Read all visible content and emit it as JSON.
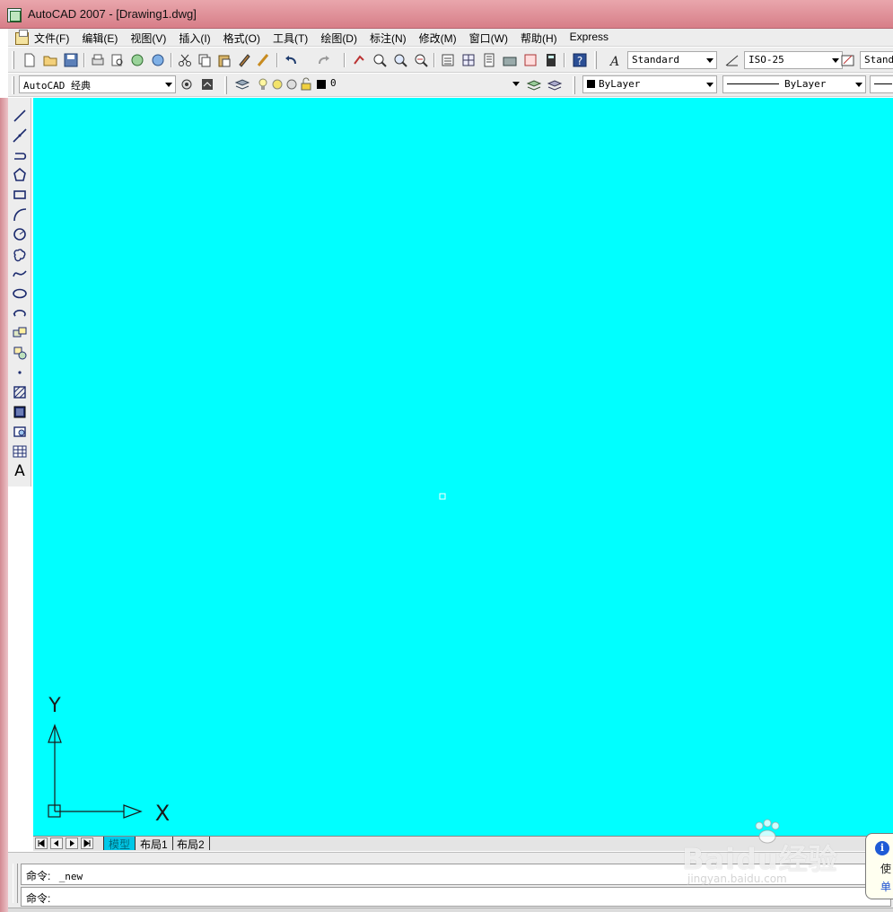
{
  "window": {
    "title": "AutoCAD 2007 - [Drawing1.dwg]"
  },
  "menu": {
    "items": [
      "文件(F)",
      "编辑(E)",
      "视图(V)",
      "插入(I)",
      "格式(O)",
      "工具(T)",
      "绘图(D)",
      "标注(N)",
      "修改(M)",
      "窗口(W)",
      "帮助(H)",
      "Express"
    ]
  },
  "toolbar_standard": {
    "text_style": "Standard",
    "dim_style": "ISO-25",
    "table_style": "Standa"
  },
  "toolbar_layers": {
    "workspace": "AutoCAD 经典",
    "layer": "0",
    "color": "ByLayer",
    "linetype": "ByLayer"
  },
  "draw_toolbar": {
    "icons": [
      "line-icon",
      "construction-line-icon",
      "polyline-icon",
      "polygon-icon",
      "rectangle-icon",
      "arc-icon",
      "circle-icon",
      "revision-cloud-icon",
      "spline-icon",
      "ellipse-icon",
      "ellipse-arc-icon",
      "insert-block-icon",
      "make-block-icon",
      "point-icon",
      "hatch-icon",
      "gradient-icon",
      "region-icon",
      "table-icon",
      "multiline-text-icon"
    ],
    "text_tool_label": "A"
  },
  "ucs": {
    "x_label": "X",
    "y_label": "Y"
  },
  "layout_tabs": [
    "模型",
    "布局1",
    "布局2"
  ],
  "command": {
    "history_prompt": "命令:",
    "history_value": "_new",
    "input_prompt": "命令:"
  },
  "balloon": {
    "line1": "使",
    "line2": "单"
  },
  "watermark": {
    "main": "Baidu经验",
    "sub": "jingyan.baidu.com"
  },
  "colors": {
    "canvas": "#00ffff",
    "title_bar": "#d98892",
    "active_tab": "#00c8e8"
  }
}
